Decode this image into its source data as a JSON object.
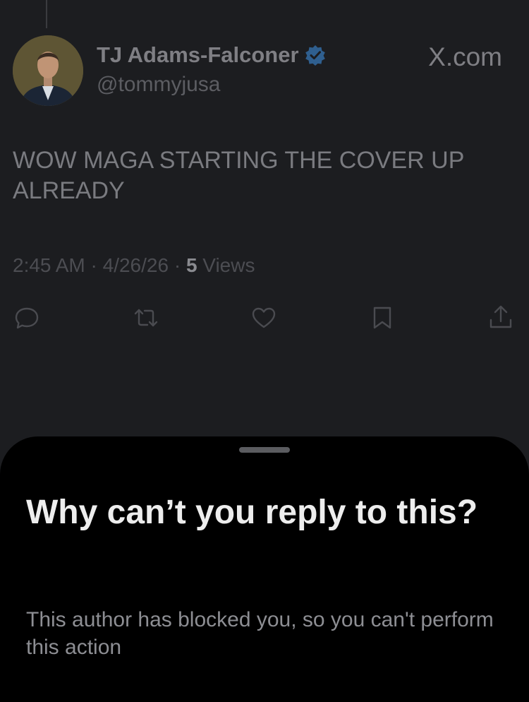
{
  "tweet": {
    "author_name": "TJ Adams-Falconer",
    "author_handle": "@tommyjusa",
    "site_label": "X.com",
    "text": "WOW MAGA STARTING THE COVER UP ALREADY",
    "time": "2:45 AM",
    "date": "4/26/26",
    "separator": " · ",
    "views_count": "5",
    "views_label": " Views"
  },
  "actions": [
    {
      "name": "reply-icon"
    },
    {
      "name": "retweet-icon"
    },
    {
      "name": "like-icon"
    },
    {
      "name": "bookmark-icon"
    },
    {
      "name": "share-icon"
    }
  ],
  "sheet": {
    "title": "Why can’t you reply to this?",
    "body": "This author has blocked you, so you can't perform this action"
  },
  "colors": {
    "background": "#1c1d20",
    "sheet_background": "#000000",
    "verified_badge": "#2f5f8f"
  }
}
